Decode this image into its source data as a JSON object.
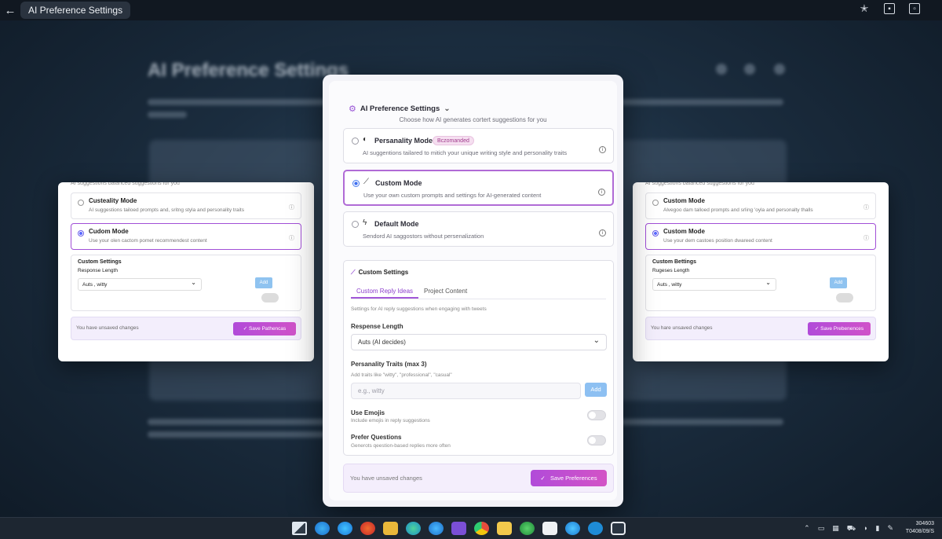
{
  "window": {
    "title": "AI Preference Settings",
    "back_icon": "arrow-left-icon"
  },
  "backdrop": {
    "heading": "AI Preference Settings"
  },
  "dialog": {
    "title": "AI Preference Settings",
    "subtitle": "Choose how AI generates cortert suggestions for you",
    "options": [
      {
        "title": "Persanality Mode",
        "badge": "Bczomanded",
        "desc": "AI suggentions tailared to mitich your unique writing style and personality traits",
        "selected": false
      },
      {
        "title": "Custom Mode",
        "desc": "Use your own custom prompts and settings for AI-generated content",
        "selected": true
      },
      {
        "title": "Default Mode",
        "desc": "Sendord AI saggostors without persenalization",
        "selected": false
      }
    ],
    "custom_settings": {
      "title": "Custom Settings",
      "tabs": [
        "Custom Reply Ideas",
        "Project Content"
      ],
      "active_tab": 0,
      "help": "Settings for AI reply suggestions when engaging with tweets",
      "response_length_label": "Respense Length",
      "response_length_value": "Auts (AI decides)",
      "traits_label": "Persanality Traits (max 3)",
      "traits_hint": "Add traits like \"witty\", \"professional\", \"casual\"",
      "traits_placeholder": "e.g., witty",
      "add_label": "Add",
      "emoji_label": "Use Emojis",
      "emoji_desc": "Include emojis in reply suggestions",
      "questions_label": "Prefer Questions",
      "questions_desc": "Generots qeestion-based replies more often"
    },
    "footer": {
      "status": "You have unsaved changes",
      "save_label": "Save Preferences"
    }
  },
  "side_left": {
    "cut": "AI suggestions balanced suggestions for you",
    "opt1_title": "Custeality Mode",
    "opt1_desc": "AI suggestions tailoed prompts and, sritng styla and personality traits",
    "opt2_title": "Cudom Mode",
    "opt2_desc": "Use your olen cactom pomet recommendest content",
    "box_title": "Custom Settings",
    "box_sub": "Response Length",
    "select_value": "Auts , witty",
    "add_label": "Add",
    "footer_status": "You have unsaved changes",
    "save_label": "Save Pathencas"
  },
  "side_right": {
    "cut": "AI suggestions balanced suggestions for you",
    "opt1_title": "Custom Mode",
    "opt1_desc": "Alvegoo dam talloed prompts and srling 'oyla and personalty thalls",
    "opt2_title": "Custom Mode",
    "opt2_desc": "Use your dem castoes position dwareed content",
    "box_title": "Custom Bettings",
    "box_sub": "Rugeses Length",
    "select_value": "Auts , witty",
    "add_label": "Add",
    "footer_status": "You hare unsaved changes",
    "save_label": "Save Prebenences"
  },
  "taskbar": {
    "time": "304603",
    "date": "T0408/09/S"
  },
  "colors": {
    "accent": "#a258d8",
    "save_gradient_start": "#b14bd9",
    "save_gradient_end": "#d353c6",
    "add_button": "#8dc0f2"
  }
}
